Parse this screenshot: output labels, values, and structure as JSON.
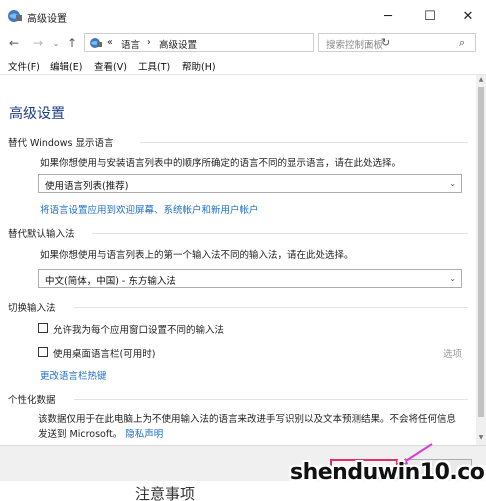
{
  "window": {
    "title": "高级设置",
    "controls": {
      "minimize": "─",
      "maximize": "☐",
      "close": "✕"
    }
  },
  "navigation": {
    "back": "←",
    "forward": "→",
    "recent": "⌄",
    "up": "↑",
    "breadcrumbs": [
      "«",
      "语言",
      "›",
      "高级设置"
    ],
    "dropdown": "⌄",
    "refresh": "↻",
    "search": {
      "placeholder": "搜索控制面板",
      "icon": "⌕"
    }
  },
  "menubar": {
    "items": [
      "文件(F)",
      "编辑(E)",
      "查看(V)",
      "工具(T)",
      "帮助(H)"
    ]
  },
  "content": {
    "title": "高级设置",
    "display_language": {
      "header": "替代 Windows 显示语言",
      "description": "如果你想使用与安装语言列表中的顺序所确定的语言不同的显示语言，请在此处选择。",
      "selected": "使用语言列表(推荐)",
      "link": "将语言设置应用到欢迎屏幕、系统帐户和新用户帐户"
    },
    "default_input": {
      "header": "替代默认输入法",
      "description": "如果你想使用与语言列表上的第一个输入法不同的输入法，请在此处选择。",
      "selected": "中文(简体，中国) - 东方输入法"
    },
    "switch_input": {
      "header": "切换输入法",
      "option1": "允许我为每个应用窗口设置不同的输入法",
      "option2": "使用桌面语言栏(可用时)",
      "options_label": "选项",
      "hotkey_link": "更改语言栏热键"
    },
    "personalization": {
      "header": "个性化数据",
      "paragraph_line1": "该数据仅用于在此电脑上为不使用输入法的语言来改进手写识别以及文本预测结果。不会将任何信息",
      "paragraph_line2": "发送到 Microsoft。",
      "privacy_link": "隐私声明"
    }
  },
  "watermark": {
    "text": "shenduwin10.com"
  },
  "below_window": {
    "text": "注意事项"
  },
  "colors": {
    "title_blue": "#1e3e8a",
    "link_blue": "#1e6fc9",
    "highlight": "#e0306a",
    "arrow": "#d93fd0"
  }
}
